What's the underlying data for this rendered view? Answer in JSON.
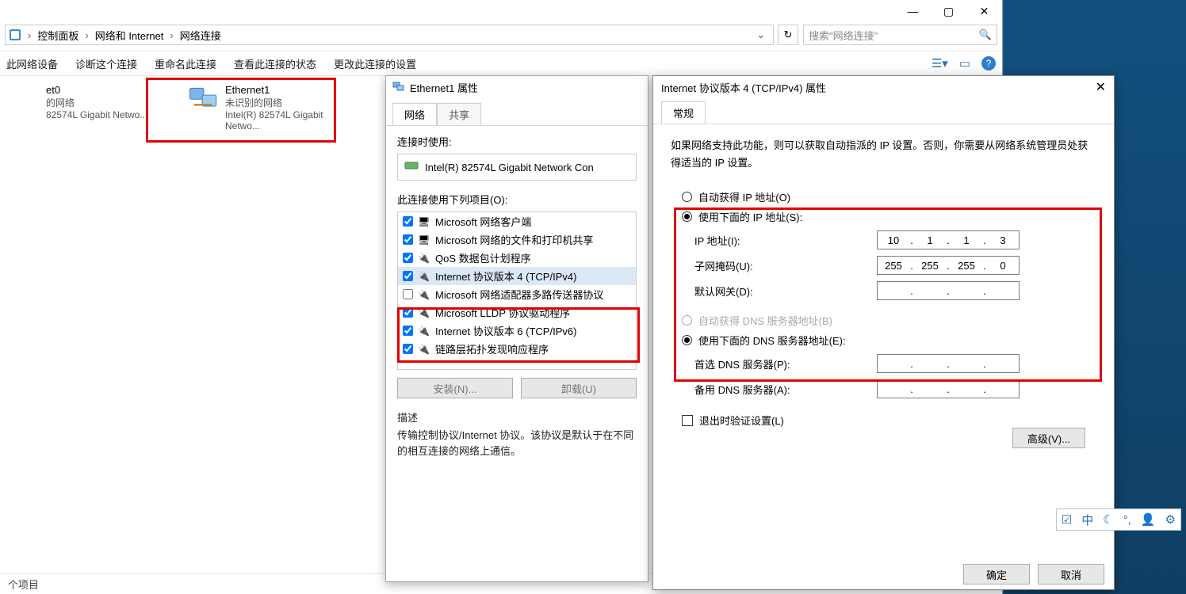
{
  "explorer": {
    "title_buttons": {
      "min": "—",
      "max": "▢",
      "close": "✕"
    },
    "breadcrumb": [
      "控制面板",
      "网络和 Internet",
      "网络连接"
    ],
    "search_placeholder": "搜索\"网络连接\"",
    "commands": [
      "此网络设备",
      "诊断这个连接",
      "重命名此连接",
      "查看此连接的状态",
      "更改此连接的设置"
    ],
    "items": [
      {
        "name": "et0",
        "line2": "的网络",
        "line3": "82574L Gigabit Netwo..."
      },
      {
        "name": "Ethernet1",
        "line2": "未识别的网络",
        "line3": "Intel(R) 82574L Gigabit Netwo..."
      }
    ],
    "status": "个项目"
  },
  "prop": {
    "title": "Ethernet1 属性",
    "tabs": [
      "网络",
      "共享"
    ],
    "connect_using_label": "连接时使用:",
    "connect_using_value": "Intel(R) 82574L Gigabit Network Con",
    "items_label": "此连接使用下列项目(O):",
    "items": [
      {
        "checked": true,
        "label": "Microsoft 网络客户端"
      },
      {
        "checked": true,
        "label": "Microsoft 网络的文件和打印机共享"
      },
      {
        "checked": true,
        "label": "QoS 数据包计划程序"
      },
      {
        "checked": true,
        "label": "Internet 协议版本 4 (TCP/IPv4)",
        "selected": true
      },
      {
        "checked": false,
        "label": "Microsoft 网络适配器多路传送器协议"
      },
      {
        "checked": true,
        "label": "Microsoft LLDP 协议驱动程序"
      },
      {
        "checked": true,
        "label": "Internet 协议版本 6 (TCP/IPv6)"
      },
      {
        "checked": true,
        "label": "链路层拓扑发现响应程序"
      }
    ],
    "buttons": {
      "install": "安装(N)...",
      "uninstall": "卸载(U)"
    },
    "desc_label": "描述",
    "desc": "传输控制协议/Internet 协议。该协议是默认于在不同的相互连接的网络上通信。"
  },
  "tcp": {
    "title": "Internet 协议版本 4 (TCP/IPv4) 属性",
    "tab": "常规",
    "help": "如果网络支持此功能，则可以获取自动指派的 IP 设置。否则，你需要从网络系统管理员处获得适当的 IP 设置。",
    "ip_auto": "自动获得 IP 地址(O)",
    "ip_manual": "使用下面的 IP 地址(S):",
    "ip_label": "IP 地址(I):",
    "mask_label": "子网掩码(U):",
    "gw_label": "默认网关(D):",
    "ip": [
      "10",
      "1",
      "1",
      "3"
    ],
    "mask": [
      "255",
      "255",
      "255",
      "0"
    ],
    "gw": [
      "",
      "",
      "",
      ""
    ],
    "dns_auto": "自动获得 DNS 服务器地址(B)",
    "dns_manual": "使用下面的 DNS 服务器地址(E):",
    "dns1_label": "首选 DNS 服务器(P):",
    "dns2_label": "备用 DNS 服务器(A):",
    "dns1": [
      "",
      "",
      "",
      ""
    ],
    "dns2": [
      "",
      "",
      "",
      ""
    ],
    "validate": "退出时验证设置(L)",
    "advanced": "高级(V)...",
    "ok": "确定",
    "cancel": "取消"
  },
  "ime": {
    "items": [
      "☑",
      "中",
      "☾",
      "°,",
      "👤",
      "⚙"
    ]
  }
}
